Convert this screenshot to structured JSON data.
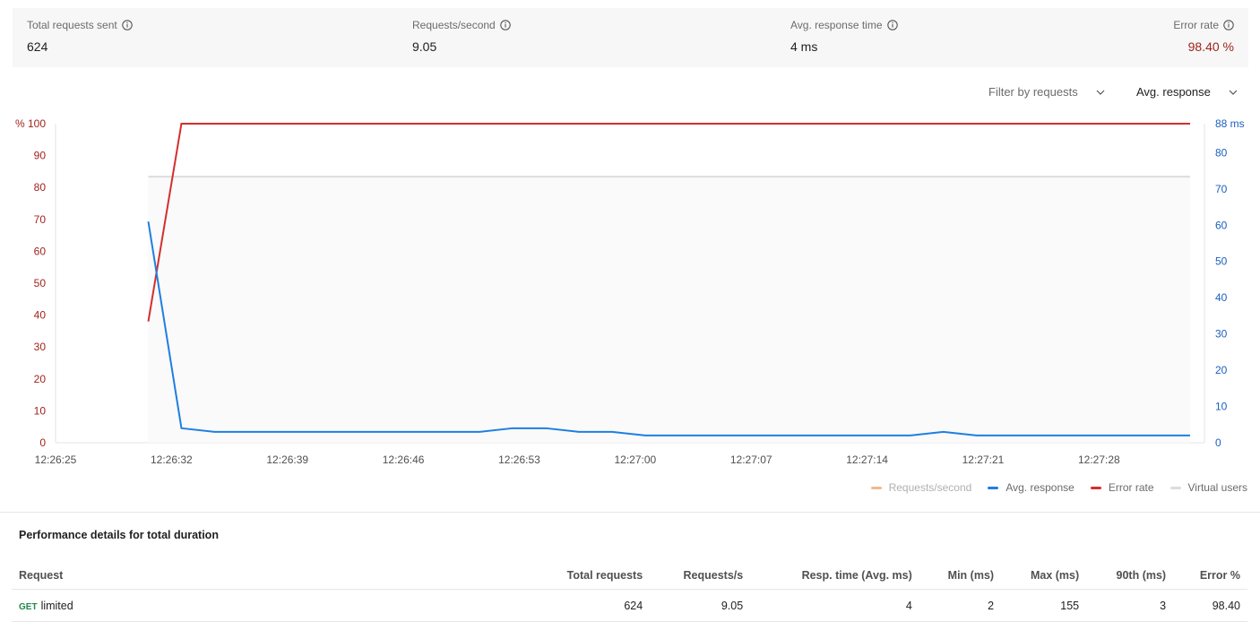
{
  "summary": {
    "total_requests": {
      "label": "Total requests sent",
      "value": "624"
    },
    "requests_per_second": {
      "label": "Requests/second",
      "value": "9.05"
    },
    "avg_response_time": {
      "label": "Avg. response time",
      "value": "4 ms"
    },
    "error_rate": {
      "label": "Error rate",
      "value": "98.40 %"
    }
  },
  "filters": {
    "filter_by_requests": "Filter by requests",
    "metric_select": "Avg. response"
  },
  "colors": {
    "error": "#d32f2f",
    "avg_response": "#1e7fe0",
    "virtual_users": "#dcdcdc",
    "requests_per_second": "#f5b98a",
    "left_axis": "#a1231b",
    "right_axis": "#1b5fbf"
  },
  "chart_data": {
    "type": "line",
    "x_ticks": [
      "12:26:25",
      "12:26:32",
      "12:26:39",
      "12:26:46",
      "12:26:53",
      "12:27:00",
      "12:27:07",
      "12:27:14",
      "12:27:21",
      "12:27:28"
    ],
    "x_range": [
      0,
      68.5
    ],
    "y_left": {
      "unit": "%",
      "range": [
        0,
        100
      ],
      "ticks": [
        "0",
        "10",
        "20",
        "30",
        "40",
        "50",
        "60",
        "70",
        "80",
        "90",
        "% 100"
      ]
    },
    "y_right": {
      "unit": "ms",
      "range": [
        0,
        88
      ],
      "ticks": [
        "0",
        "10",
        "20",
        "30",
        "40",
        "50",
        "60",
        "70",
        "80",
        "88 ms"
      ]
    },
    "series": [
      {
        "name": "Error rate",
        "axis": "left",
        "x": [
          5.6,
          7.6,
          68.5
        ],
        "y": [
          38,
          100,
          100
        ]
      },
      {
        "name": "Avg. response",
        "axis": "right",
        "x": [
          5.6,
          7.6,
          9.6,
          11.6,
          13.6,
          15.6,
          17.6,
          19.6,
          21.6,
          23.6,
          25.6,
          27.6,
          29.6,
          31.6,
          33.6,
          35.6,
          37.6,
          39.6,
          41.6,
          43.6,
          45.6,
          47.6,
          49.6,
          51.6,
          53.6,
          55.6,
          57.6,
          59.6,
          61.6,
          63.6,
          65.6,
          68.5
        ],
        "y": [
          61,
          4,
          3,
          3,
          3,
          3,
          3,
          3,
          3,
          3,
          3,
          4,
          4,
          3,
          3,
          2,
          2,
          2,
          2,
          2,
          2,
          2,
          2,
          2,
          3,
          2,
          2,
          2,
          2,
          2,
          2,
          2
        ]
      },
      {
        "name": "Virtual users",
        "axis": "left",
        "x": [
          5.6,
          68.5
        ],
        "y": [
          83.4,
          83.4
        ]
      }
    ],
    "legend": [
      "Requests/second",
      "Avg. response",
      "Error rate",
      "Virtual users"
    ],
    "legend_placement": "bottom-right",
    "grid": false
  },
  "table": {
    "title": "Performance details for total duration",
    "headers": [
      "Request",
      "Total requests",
      "Requests/s",
      "Resp. time (Avg. ms)",
      "Min (ms)",
      "Max (ms)",
      "90th (ms)",
      "Error %"
    ],
    "rows": [
      {
        "method": "GET",
        "name": "limited",
        "total": "624",
        "rps": "9.05",
        "avg": "4",
        "min": "2",
        "max": "155",
        "p90": "3",
        "error": "98.40"
      }
    ]
  }
}
